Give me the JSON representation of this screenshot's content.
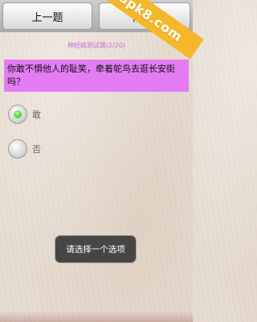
{
  "toolbar": {
    "prev_label": "上一题",
    "next_label": "下一题"
  },
  "watermark": "apk8.com",
  "quiz": {
    "subtitle": "神经病测试题(2/20)",
    "question": "你敢不惧他人的耻笑，牵着鸵鸟去逛长安街吗？",
    "options": [
      {
        "label": "敢",
        "selected": true
      },
      {
        "label": "否",
        "selected": false
      }
    ]
  },
  "toast": "请选择一个选项"
}
